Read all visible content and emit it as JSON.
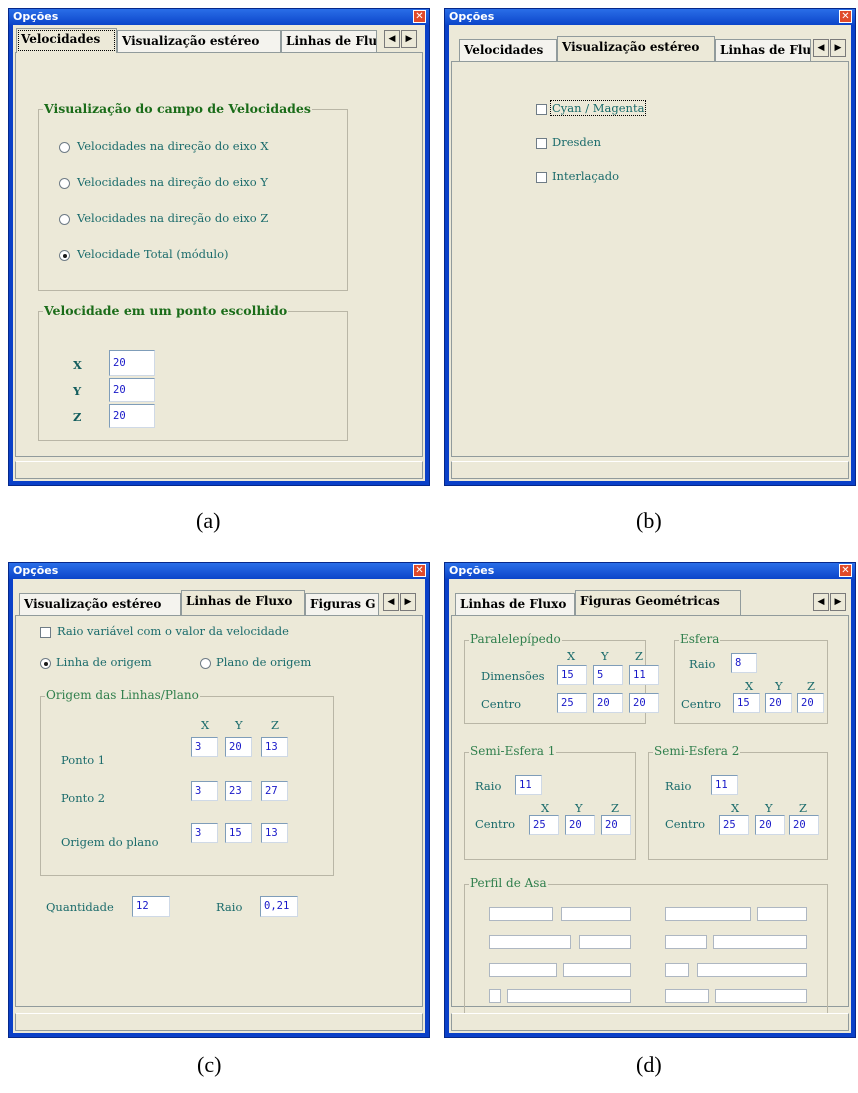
{
  "window_title": "Opções",
  "close_glyph": "✕",
  "arrows": {
    "left": "◀",
    "right": "▶"
  },
  "captions": [
    "(a)",
    "(b)",
    "(c)",
    "(d)"
  ],
  "panel_a": {
    "tabs": [
      "Velocidades",
      "Visualização estéreo",
      "Linhas de Flu"
    ],
    "group_campo": "Visualização  do campo de Velocidades",
    "radios": [
      {
        "label": "Velocidades na direção do eixo X",
        "selected": false
      },
      {
        "label": "Velocidades na direção do eixo Y",
        "selected": false
      },
      {
        "label": "Velocidades na direção do eixo Z",
        "selected": false
      },
      {
        "label": "Velocidade Total (módulo)",
        "selected": true
      }
    ],
    "group_ponto": "Velocidade em um ponto escolhido",
    "coords": [
      {
        "label": "X",
        "value": "20"
      },
      {
        "label": "Y",
        "value": "20"
      },
      {
        "label": "Z",
        "value": "20"
      }
    ]
  },
  "panel_b": {
    "tabs": [
      "Velocidades",
      "Visualização estéreo",
      "Linhas de Flu"
    ],
    "checks": [
      {
        "label": "Cyan / Magenta",
        "checked": false
      },
      {
        "label": "Dresden",
        "checked": false
      },
      {
        "label": "Interlaçado",
        "checked": false
      }
    ]
  },
  "panel_c": {
    "tabs": [
      "Visualização estéreo",
      "Linhas de Fluxo",
      "Figuras G"
    ],
    "raio_check": "Raio variável com o valor da velocidade",
    "radio_linha": "Linha de origem",
    "radio_plano": "Plano de origem",
    "group_origem": "Origem das Linhas/Plano",
    "col_headers": [
      "X",
      "Y",
      "Z"
    ],
    "rows": [
      {
        "label": "Ponto 1",
        "values": [
          "3",
          "20",
          "13"
        ]
      },
      {
        "label": "Ponto 2",
        "values": [
          "3",
          "23",
          "27"
        ]
      },
      {
        "label": "Origem do plano",
        "values": [
          "3",
          "15",
          "13"
        ]
      }
    ],
    "quantidade_label": "Quantidade",
    "quantidade_value": "12",
    "raio_label": "Raio",
    "raio_value": "0,21"
  },
  "panel_d": {
    "tabs": [
      "Linhas de Fluxo",
      "Figuras Geométricas"
    ],
    "paralelepipedo": {
      "title": "Paralelepípedo",
      "headers": [
        "X",
        "Y",
        "Z"
      ],
      "dim_label": "Dimensões",
      "dim_values": [
        "15",
        "5",
        "11"
      ],
      "centro_label": "Centro",
      "centro_values": [
        "25",
        "20",
        "20"
      ]
    },
    "esfera": {
      "title": "Esfera",
      "raio_label": "Raio",
      "raio_value": "8",
      "centro_label": "Centro",
      "headers": [
        "X",
        "Y",
        "Z"
      ],
      "centro_values": [
        "15",
        "20",
        "20"
      ]
    },
    "semi1": {
      "title": "Semi-Esfera 1",
      "raio_label": "Raio",
      "raio_value": "11",
      "centro_label": "Centro",
      "headers": [
        "X",
        "Y",
        "Z"
      ],
      "centro_values": [
        "25",
        "20",
        "20"
      ]
    },
    "semi2": {
      "title": "Semi-Esfera 2",
      "raio_label": "Raio",
      "raio_value": "11",
      "centro_label": "Centro",
      "headers": [
        "X",
        "Y",
        "Z"
      ],
      "centro_values": [
        "25",
        "20",
        "20"
      ]
    },
    "perfil_title": "Perfil de Asa"
  }
}
